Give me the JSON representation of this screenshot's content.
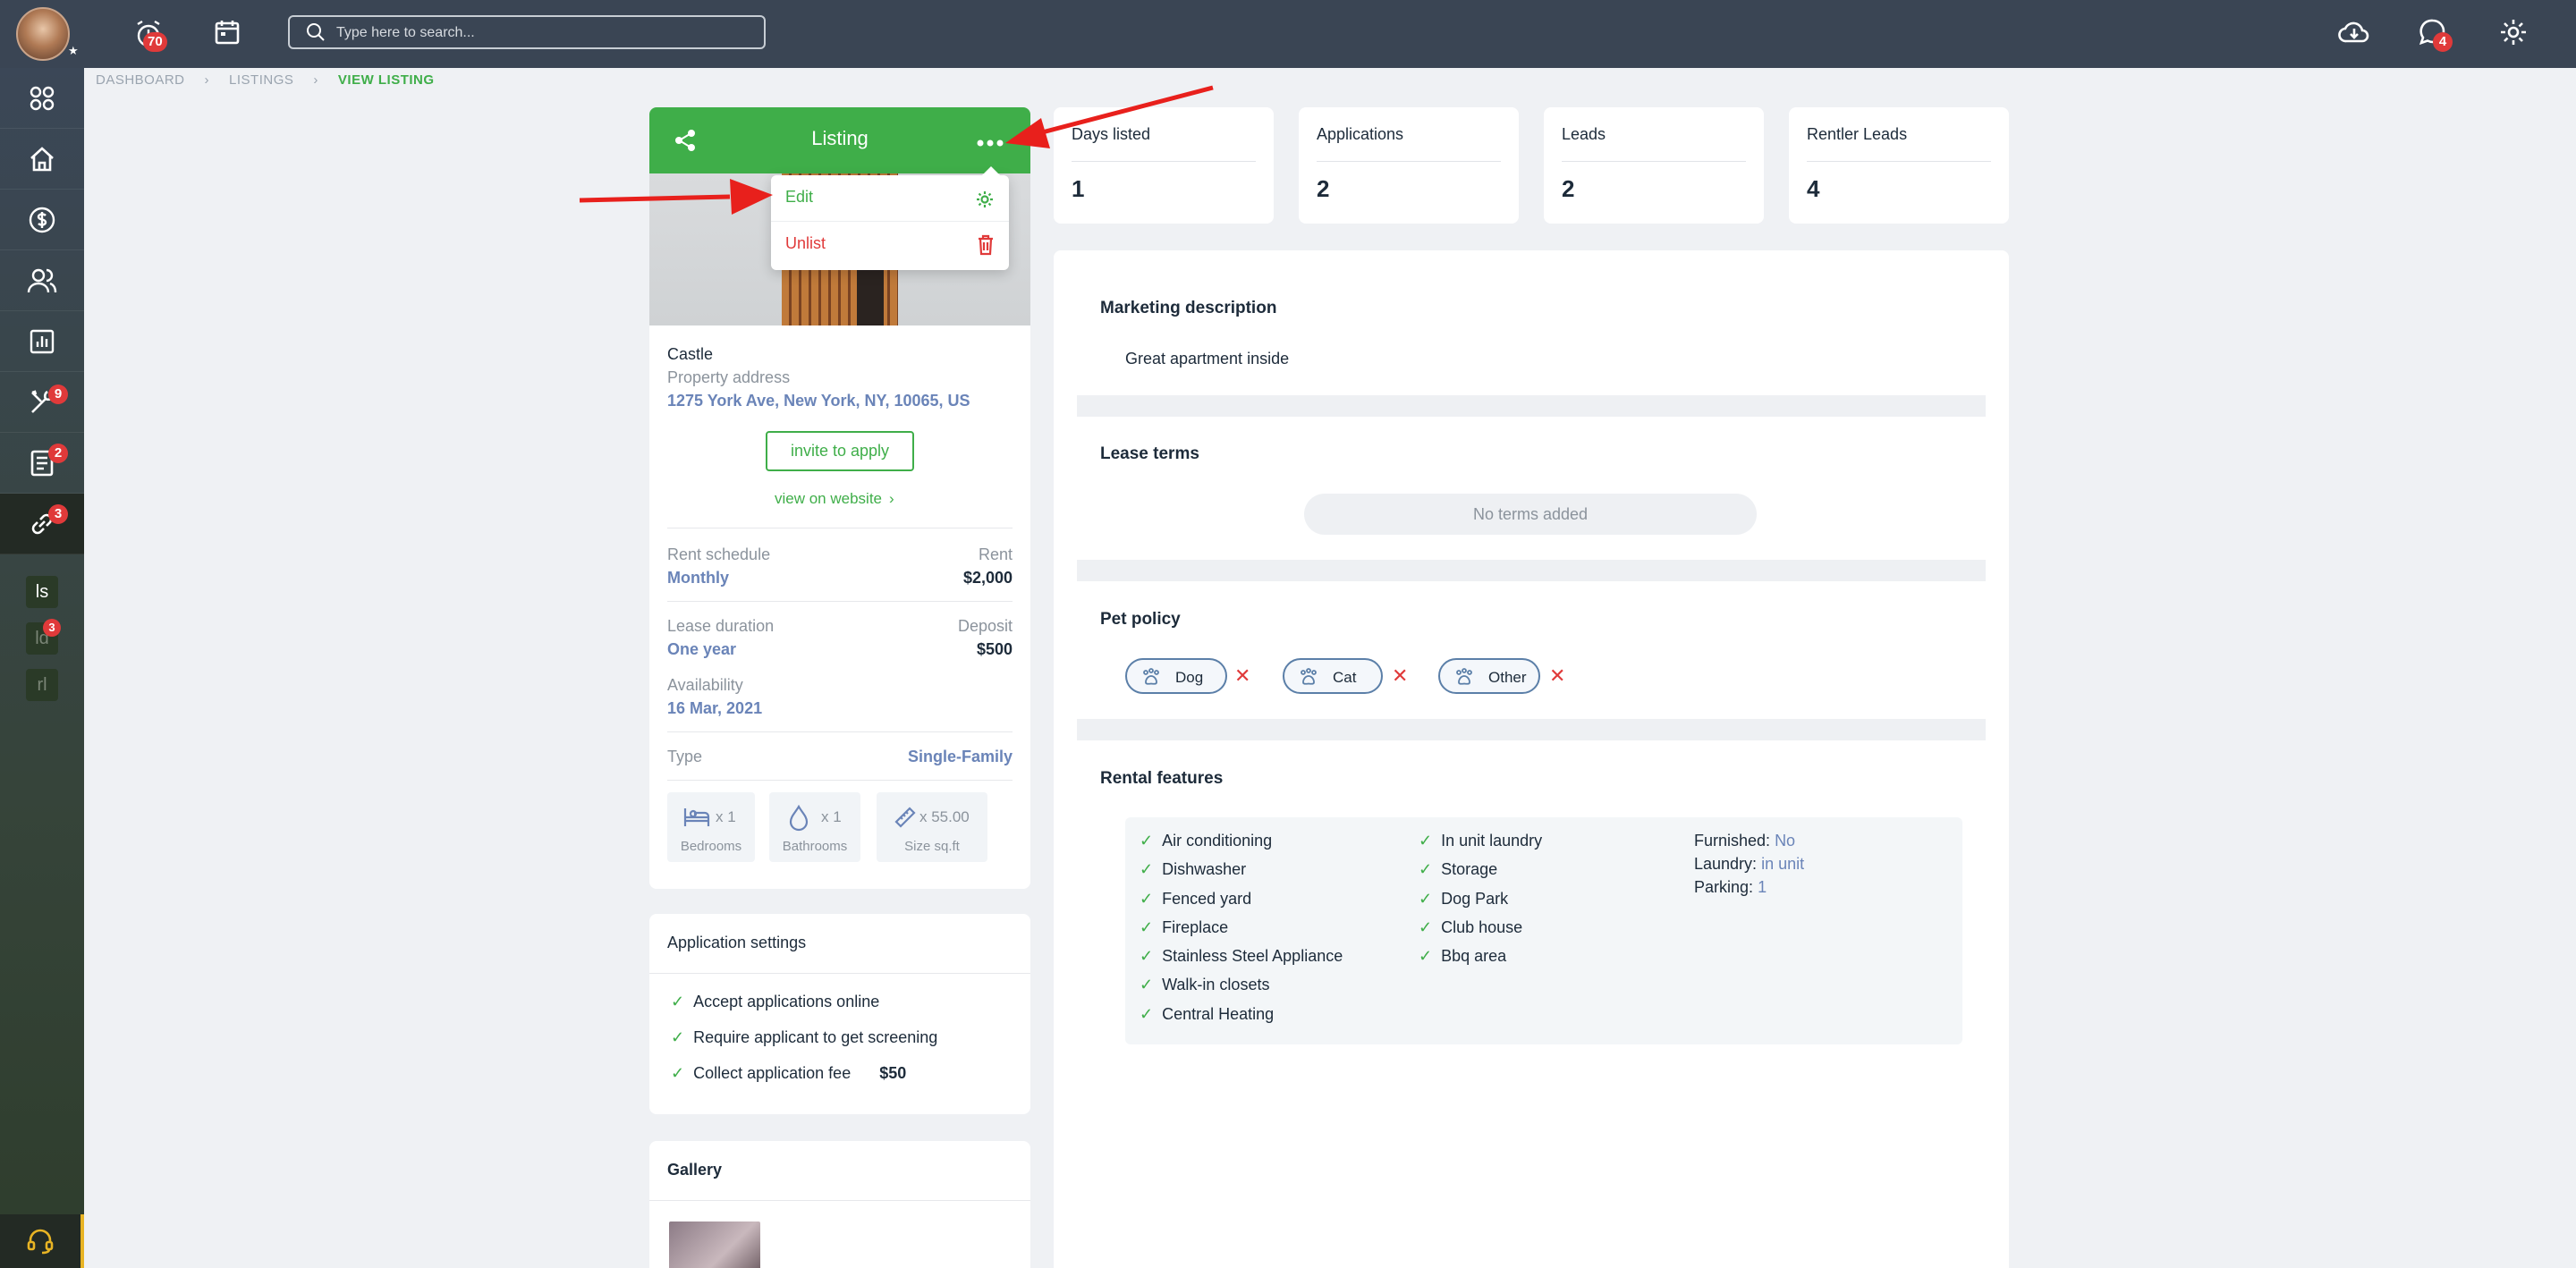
{
  "topbar": {
    "notifications_badge": "70",
    "search_placeholder": "Type here to search...",
    "messages_badge": "4"
  },
  "sidebar": {
    "items": [
      {
        "icon": "apps-grid-icon"
      },
      {
        "icon": "home-icon"
      },
      {
        "icon": "dollar-icon"
      },
      {
        "icon": "users-icon"
      },
      {
        "icon": "chart-icon"
      },
      {
        "icon": "tools-icon",
        "badge": "9"
      },
      {
        "icon": "document-icon",
        "badge": "2"
      },
      {
        "icon": "link-icon",
        "badge": "3"
      }
    ],
    "sub_items": [
      {
        "label": "ls"
      },
      {
        "label": "ld",
        "badge": "3"
      },
      {
        "label": "rl"
      }
    ]
  },
  "breadcrumb": [
    "DASHBOARD",
    "LISTINGS",
    "VIEW LISTING"
  ],
  "listing_card": {
    "header_title": "Listing",
    "menu": {
      "edit": "Edit",
      "unlist": "Unlist"
    },
    "name": "Castle",
    "address_label": "Property address",
    "address": "1275 York Ave, New York, NY, 10065, US",
    "invite_button": "invite to apply",
    "website_link": "view on website",
    "rent_schedule_label": "Rent schedule",
    "rent_schedule": "Monthly",
    "rent_label": "Rent",
    "rent": "$2,000",
    "lease_duration_label": "Lease duration",
    "lease_duration": "One year",
    "deposit_label": "Deposit",
    "deposit": "$500",
    "availability_label": "Availability",
    "availability": "16 Mar, 2021",
    "type_label": "Type",
    "type": "Single-Family",
    "features": [
      {
        "value": "x 1",
        "label": "Bedrooms"
      },
      {
        "value": "x 1",
        "label": "Bathrooms"
      },
      {
        "value": "x 55.00",
        "label": "Size sq.ft"
      }
    ]
  },
  "application_settings": {
    "title": "Application settings",
    "items": [
      "Accept applications online",
      "Require applicant to get screening",
      "Collect application fee"
    ],
    "fee": "$50"
  },
  "gallery": {
    "title": "Gallery"
  },
  "stats": [
    {
      "title": "Days listed",
      "value": "1"
    },
    {
      "title": "Applications",
      "value": "2"
    },
    {
      "title": "Leads",
      "value": "2"
    },
    {
      "title": "Rentler Leads",
      "value": "4"
    }
  ],
  "details": {
    "marketing_title": "Marketing description",
    "marketing_text": "Great apartment inside",
    "lease_title": "Lease terms",
    "lease_empty": "No terms added",
    "pet_title": "Pet policy",
    "pets": [
      "Dog",
      "Cat",
      "Other"
    ],
    "features_title": "Rental features",
    "features_col1": [
      "Air conditioning",
      "Dishwasher",
      "Fenced yard",
      "Fireplace",
      "Stainless Steel Appliance",
      "Walk-in closets",
      "Central Heating"
    ],
    "features_col2": [
      "In unit laundry",
      "Storage",
      "Dog Park",
      "Club house",
      "Bbq area"
    ],
    "furnished_label": "Furnished:",
    "furnished": "No",
    "laundry_label": "Laundry:",
    "laundry": "in unit",
    "parking_label": "Parking:",
    "parking": "1"
  },
  "colors": {
    "accent": "#3fae49",
    "topbar": "#3a4554",
    "danger": "#e03a3a",
    "annotation": "#e8201c"
  }
}
